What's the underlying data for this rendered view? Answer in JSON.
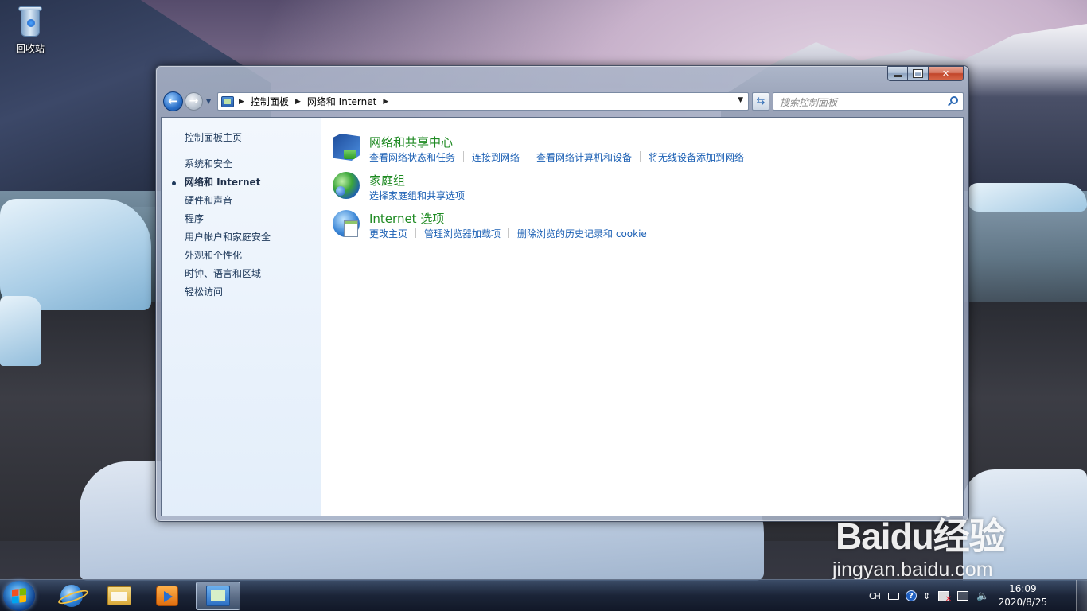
{
  "desktop": {
    "icons": [
      {
        "label": "回收站",
        "icon": "recycle-bin-icon"
      }
    ]
  },
  "window": {
    "caption_buttons": [
      "minimize",
      "maximize",
      "close"
    ],
    "address": {
      "crumbs": [
        "控制面板",
        "网络和 Internet"
      ]
    },
    "search": {
      "placeholder": "搜索控制面板"
    },
    "sidebar": {
      "home": "控制面板主页",
      "items": [
        {
          "label": "系统和安全",
          "active": false
        },
        {
          "label": "网络和 Internet",
          "active": true
        },
        {
          "label": "硬件和声音",
          "active": false
        },
        {
          "label": "程序",
          "active": false
        },
        {
          "label": "用户帐户和家庭安全",
          "active": false
        },
        {
          "label": "外观和个性化",
          "active": false
        },
        {
          "label": "时钟、语言和区域",
          "active": false
        },
        {
          "label": "轻松访问",
          "active": false
        }
      ]
    },
    "categories": [
      {
        "title": "网络和共享中心",
        "icon": "network-sharing-icon",
        "links": [
          "查看网络状态和任务",
          "连接到网络",
          "查看网络计算机和设备",
          "将无线设备添加到网络"
        ]
      },
      {
        "title": "家庭组",
        "icon": "homegroup-icon",
        "links": [
          "选择家庭组和共享选项"
        ]
      },
      {
        "title": "Internet 选项",
        "icon": "internet-options-icon",
        "links": [
          "更改主页",
          "管理浏览器加载项",
          "删除浏览的历史记录和 cookie"
        ]
      }
    ]
  },
  "taskbar": {
    "pinned": [
      "internet-explorer-icon",
      "file-explorer-icon",
      "media-player-icon",
      "control-panel-icon"
    ],
    "tray": {
      "lang": "CH",
      "time": "16:09",
      "date": "2020/8/25"
    }
  },
  "watermark": {
    "brand": "Baidu经验",
    "url": "jingyan.baidu.com"
  },
  "colors": {
    "link": "#1a5fb4",
    "category_title": "#1e8a22",
    "sidebar_text": "#1e395b"
  }
}
